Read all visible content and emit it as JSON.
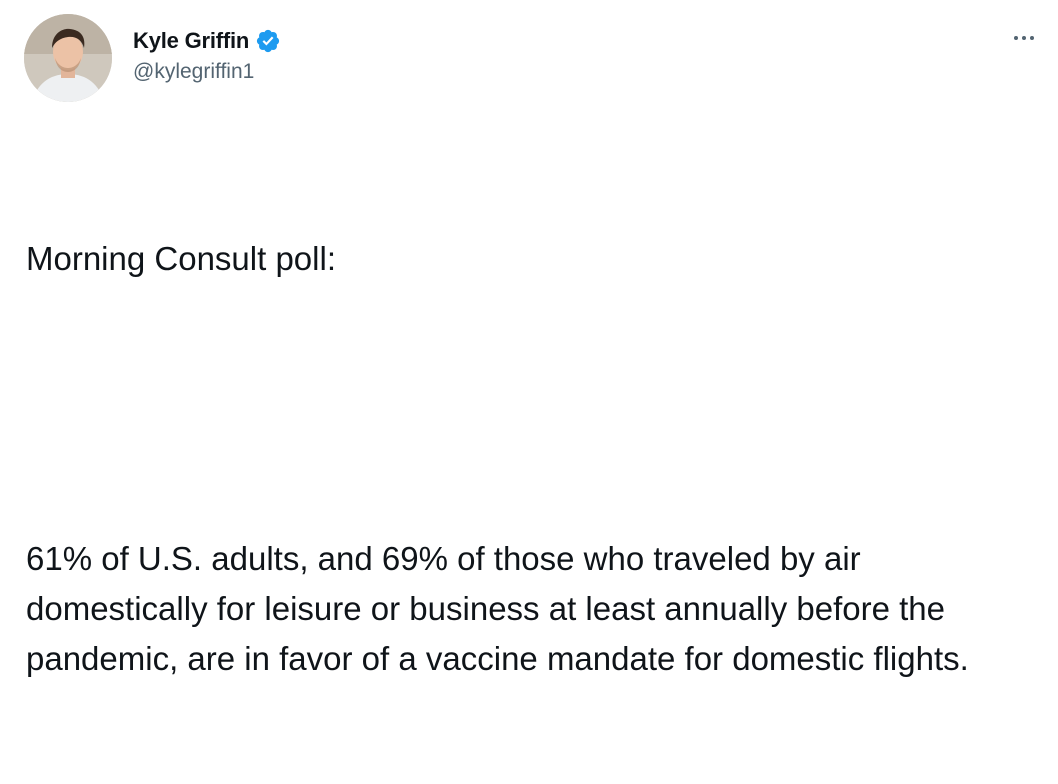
{
  "author": {
    "name": "Kyle Griffin",
    "handle": "@kylegriffin1",
    "verified_icon": "verified-badge-icon",
    "verified_color": "#1d9bf0"
  },
  "menu": {
    "icon": "more-options-icon"
  },
  "tweet": {
    "line1": "Morning Consult poll:",
    "paragraph2": "61% of U.S. adults, and 69% of those who traveled by air domestically for leisure or business at least annually before the pandemic, are in favor of a vaccine mandate for domestic flights."
  }
}
